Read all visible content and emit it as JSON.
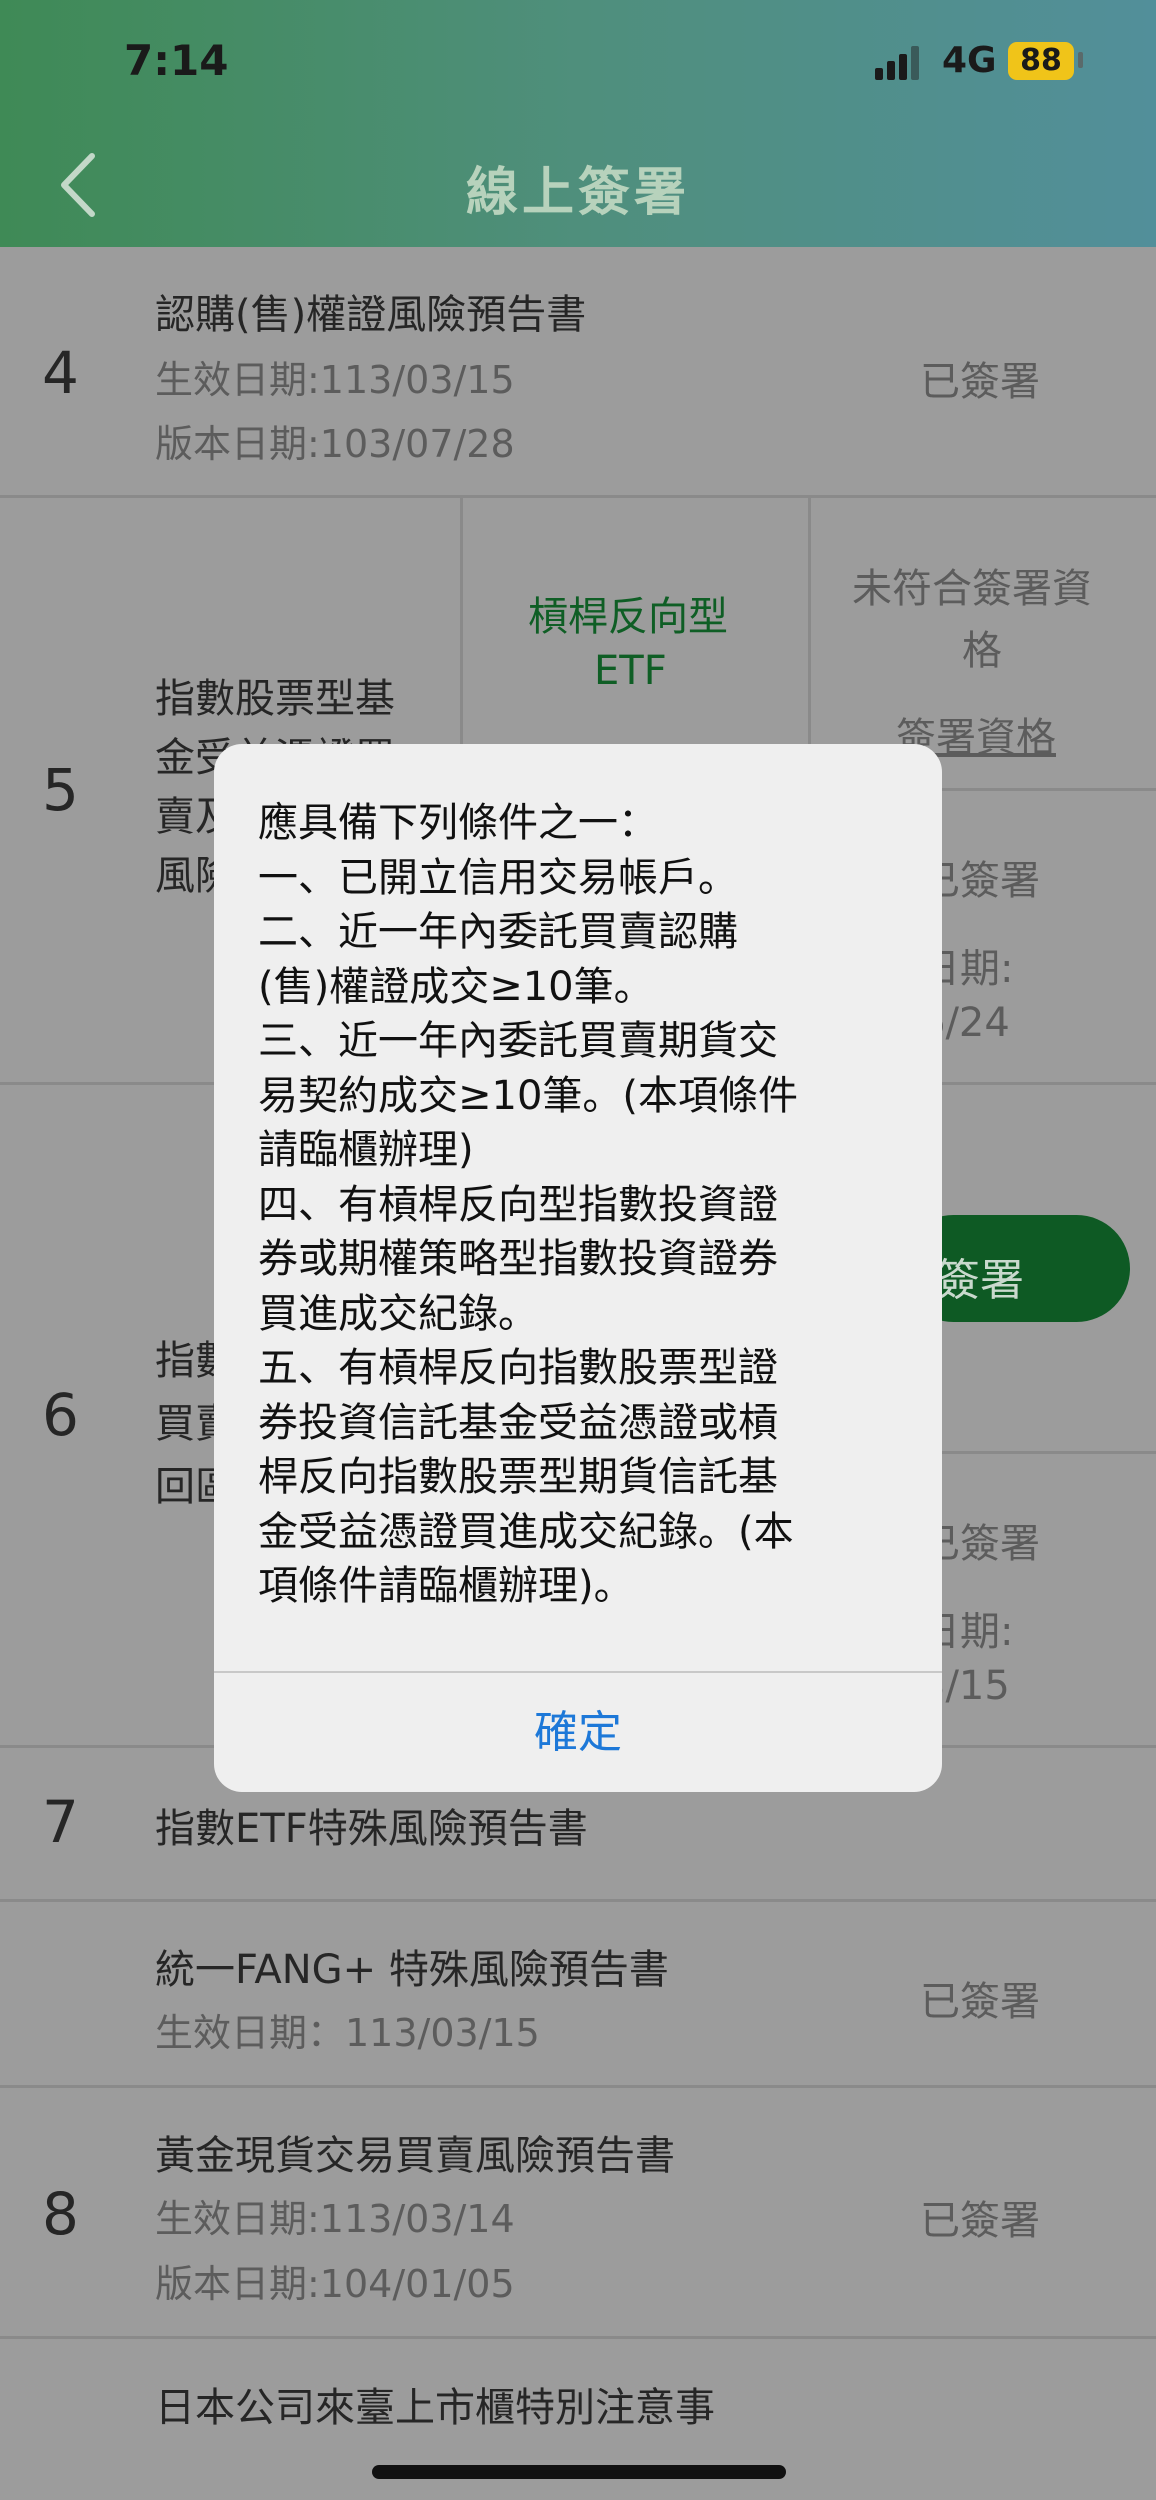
{
  "status_bar": {
    "time": "7:14",
    "network": "4G",
    "battery": "88"
  },
  "nav": {
    "title": "線上簽署"
  },
  "rows": {
    "r4": {
      "number": "4",
      "title": "認購(售)權證風險預告書",
      "effective": "生效日期:113/03/15",
      "version": "版本日期:103/07/28",
      "status": "已簽署"
    },
    "r5": {
      "number": "5",
      "title_lines": [
        "指數股票型基",
        "金受益憑證買",
        "賣及",
        "風險"
      ],
      "category_lines": [
        "槓桿反向型",
        "ETF"
      ],
      "status_lines": [
        "未符合簽署資",
        "格"
      ],
      "status_link": "簽署資格",
      "signed": "已簽署",
      "date_label": "日期:",
      "date_value": "6/24"
    },
    "r6": {
      "number": "6",
      "title_lines": [
        "指數",
        "買賣",
        "回區"
      ],
      "sign_button": "簽署",
      "signed": "已簽署",
      "date_label": "日期:",
      "date_value": "3/15"
    },
    "r7": {
      "number": "7",
      "title": "指數ETF特殊風險預告書"
    },
    "r7b": {
      "title": "統一FANG+ 特殊風險預告書",
      "effective": "生效日期：113/03/15",
      "status": "已簽署"
    },
    "r8": {
      "number": "8",
      "title": "黃金現貨交易買賣風險預告書",
      "effective": "生效日期:113/03/14",
      "version": "版本日期:104/01/05",
      "status": "已簽署"
    },
    "r9": {
      "title": "日本公司來臺上市櫃特別注意事"
    }
  },
  "alert": {
    "lines": [
      "應具備下列條件之一：",
      "一、已開立信用交易帳戶。",
      "二、近一年內委託買賣認購",
      "(售)權證成交≥10筆。",
      "三、近一年內委託買賣期貨交",
      "易契約成交≥10筆。(本項條件",
      "請臨櫃辦理)",
      "四、有槓桿反向型指數投資證",
      "券或期權策略型指數投資證券",
      "買進成交紀錄。",
      "五、有槓桿反向指數股票型證",
      "券投資信託基金受益憑證或槓",
      "桿反向指數股票型期貨信託基",
      "金受益憑證買進成交紀錄。(本",
      "項條件請臨櫃辦理)。"
    ],
    "confirm": "確定"
  }
}
